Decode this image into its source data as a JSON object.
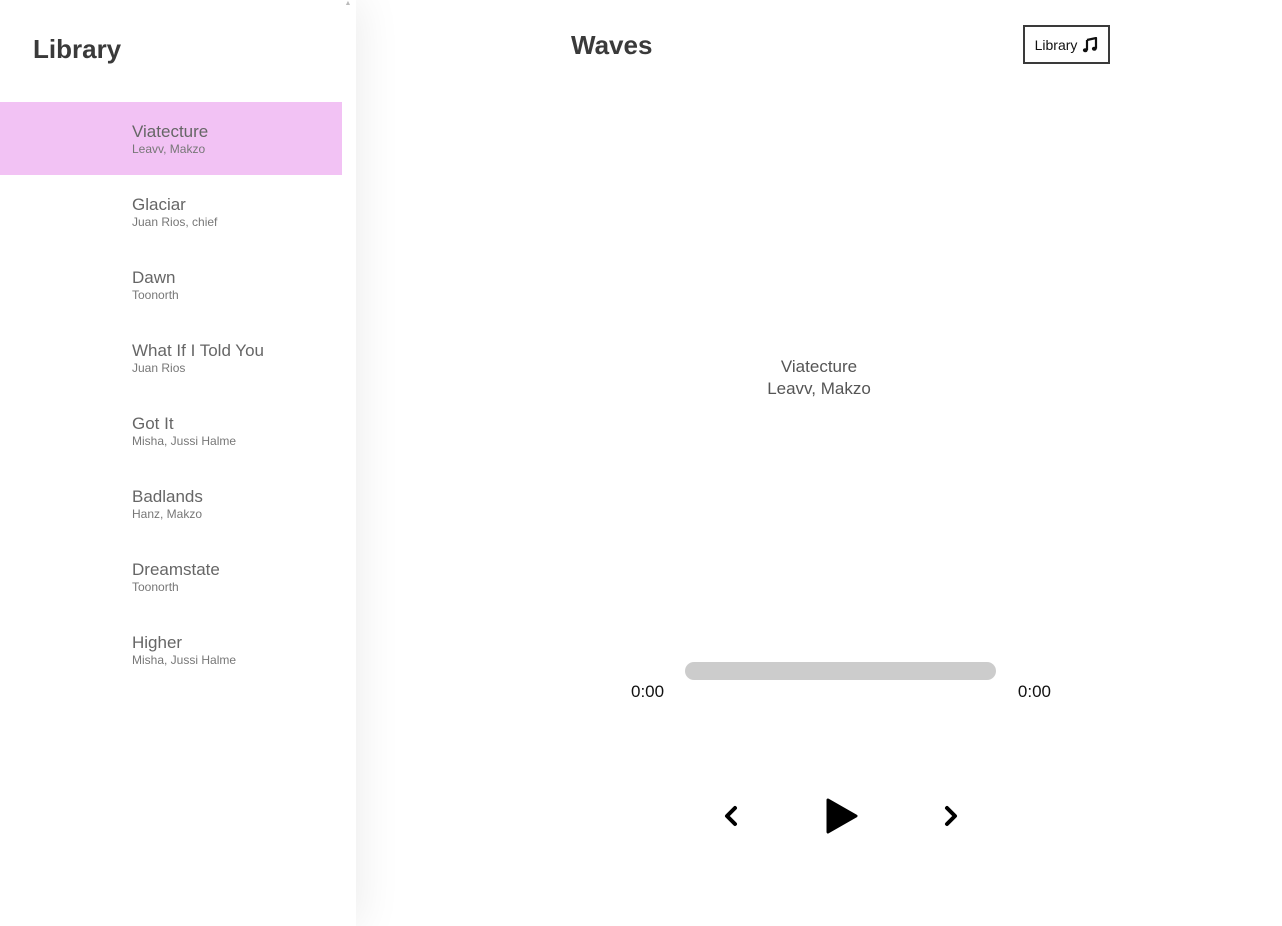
{
  "sidebar": {
    "title": "Library",
    "songs": [
      {
        "title": "Viatecture",
        "artist": "Leavv, Makzo",
        "active": true
      },
      {
        "title": "Glaciar",
        "artist": "Juan Rios, chief",
        "active": false
      },
      {
        "title": "Dawn",
        "artist": "Toonorth",
        "active": false
      },
      {
        "title": "What If I Told You",
        "artist": "Juan Rios",
        "active": false
      },
      {
        "title": "Got It",
        "artist": "Misha, Jussi Halme",
        "active": false
      },
      {
        "title": "Badlands",
        "artist": "Hanz, Makzo",
        "active": false
      },
      {
        "title": "Dreamstate",
        "artist": "Toonorth",
        "active": false
      },
      {
        "title": "Higher",
        "artist": "Misha, Jussi Halme",
        "active": false
      }
    ]
  },
  "header": {
    "app_title": "Waves",
    "library_button_label": "Library",
    "library_button_icon": "music-note-icon"
  },
  "now_playing": {
    "title": "Viatecture",
    "artist": "Leavv, Makzo"
  },
  "player": {
    "current_time": "0:00",
    "duration": "0:00",
    "progress_fraction": 0,
    "controls": {
      "prev_icon": "chevron-left-icon",
      "play_icon": "play-icon",
      "next_icon": "chevron-right-icon"
    }
  },
  "colors": {
    "active_song_bg": "#f2c2f4",
    "progress_track": "#cccccc"
  }
}
